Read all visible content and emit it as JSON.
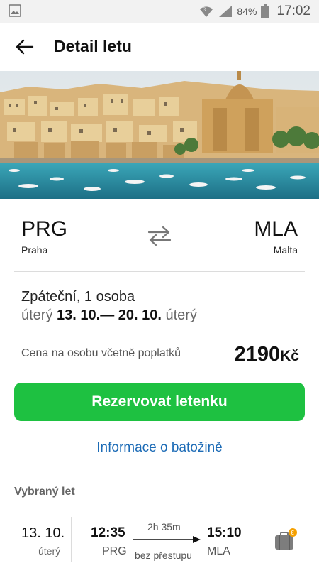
{
  "status_bar": {
    "battery_percent": "84%",
    "time": "17:02",
    "icons": [
      "gallery-notification-icon",
      "wifi-icon",
      "signal-icon",
      "battery-icon"
    ]
  },
  "header": {
    "title": "Detail letu",
    "back_icon": "arrow-left-icon"
  },
  "route": {
    "from_code": "PRG",
    "from_city": "Praha",
    "to_code": "MLA",
    "to_city": "Malta",
    "swap_icon": "swap-arrows-icon"
  },
  "trip": {
    "type": "Zpáteční, 1 osoba",
    "depart_day": "úterý",
    "depart_date": "13. 10.",
    "separator": "—",
    "return_date": "20. 10.",
    "return_day": "úterý"
  },
  "price": {
    "label": "Cena na osobu včetně poplatků",
    "amount": "2190",
    "currency": "Kč"
  },
  "actions": {
    "book_label": "Rezervovat letenku",
    "baggage_label": "Informace o batožině"
  },
  "selected_flight": {
    "section_label": "Vybraný let",
    "date": "13. 10.",
    "day": "úterý",
    "departure_time": "12:35",
    "departure_code": "PRG",
    "duration": "2h 35m",
    "stops": "bez přestupu",
    "arrival_time": "15:10",
    "arrival_code": "MLA",
    "baggage_icon": "suitcase-euro-icon"
  },
  "colors": {
    "accent_green": "#1ec141",
    "link_blue": "#1c6bb6",
    "badge_orange": "#f5a000"
  }
}
